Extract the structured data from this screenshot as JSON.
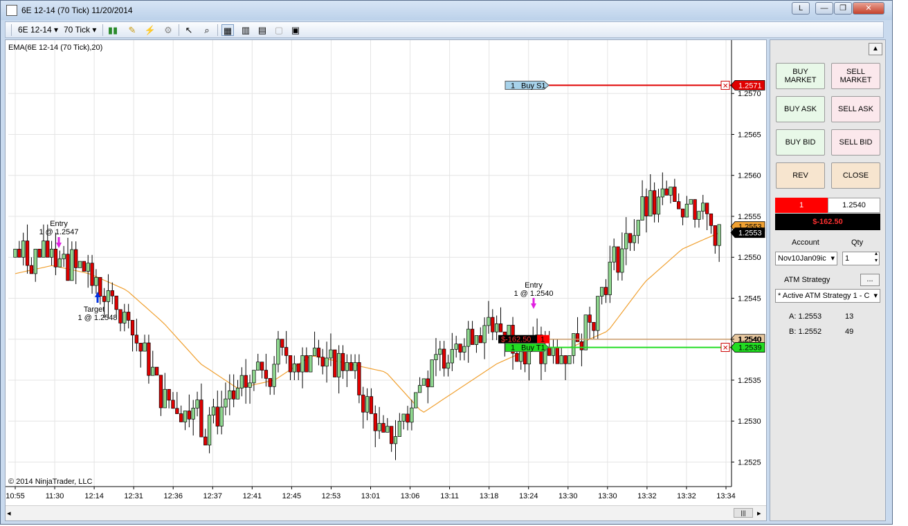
{
  "window": {
    "title": "6E 12-14 (70 Tick)  11/20/2014",
    "link_button": "L",
    "minimize_glyph": "—",
    "restore_glyph": "❐",
    "close_glyph": "✕"
  },
  "toolbar": {
    "instrument": "6E 12-14",
    "interval": "70 Tick"
  },
  "chart": {
    "indicator_label": "EMA(6E 12-14 (70 Tick),20)",
    "copyright": "© 2014 NinjaTrader, LLC",
    "y_ticks": [
      "1.2570",
      "1.2565",
      "1.2560",
      "1.2555",
      "1.2550",
      "1.2545",
      "1.2540",
      "1.2535",
      "1.2530",
      "1.2525"
    ],
    "x_ticks": [
      "10:55",
      "11:30",
      "12:14",
      "12:31",
      "12:36",
      "12:37",
      "12:41",
      "12:45",
      "12:53",
      "13:01",
      "13:06",
      "13:11",
      "13:18",
      "13:24",
      "13:30",
      "13:30",
      "13:32",
      "13:32",
      "13:34"
    ],
    "price_labels": {
      "buy_stop": "1.2571",
      "last": "1.2553",
      "avg_entry": "1.2540",
      "target": "1.2539",
      "ask_partial": "1.2553"
    },
    "order_tags": {
      "stop": {
        "qty": "1",
        "label": "Buy S1"
      },
      "target": {
        "qty": "1",
        "label": "Buy T1"
      },
      "position": {
        "pnl": "$-162.50",
        "qty": "1"
      }
    },
    "annotations": {
      "entry1": "Entry",
      "entry1_detail": "1 @ 1.2547",
      "target1": "Target",
      "target1_detail": "1 @ 1.2548",
      "entry2": "Entry",
      "entry2_detail": "1 @ 1.2540"
    },
    "colors": {
      "up": "#8fd88f",
      "down": "#e00000",
      "ema": "#f0a030",
      "stop_line": "#e00000",
      "target_line": "#22dd22",
      "entry_line": "#c99a6a"
    }
  },
  "chart_data": {
    "type": "candlestick",
    "title": "6E 12-14 (70 Tick)",
    "ylim": [
      1.2522,
      1.2575
    ],
    "series": [
      {
        "name": "EMA(6E 12-14 (70 Tick),20)",
        "values": [
          1.2548,
          1.2549,
          1.2548,
          1.2546,
          1.2542,
          1.2537,
          1.2534,
          1.2535,
          1.2538,
          1.2537,
          1.2536,
          1.2531,
          1.2534,
          1.2537,
          1.2539,
          1.2539,
          1.2541,
          1.2547,
          1.2551,
          1.2553
        ]
      },
      {
        "name": "Price",
        "values": [
          1.255,
          1.255,
          1.2548,
          1.2542,
          1.2533,
          1.253,
          1.2533,
          1.2538,
          1.2538,
          1.2537,
          1.2527,
          1.2535,
          1.2541,
          1.2542,
          1.2538,
          1.2538,
          1.2548,
          1.2556,
          1.2557,
          1.2553
        ]
      }
    ]
  },
  "panel": {
    "buttons": {
      "buy_market": "BUY\nMARKET",
      "sell_market": "SELL\nMARKET",
      "buy_ask": "BUY ASK",
      "sell_ask": "SELL ASK",
      "buy_bid": "BUY BID",
      "sell_bid": "SELL BID",
      "rev": "REV",
      "close": "CLOSE"
    },
    "position_qty": "1",
    "position_price": "1.2540",
    "pnl": "$-162.50",
    "account_label": "Account",
    "qty_label": "Qty",
    "account_value": "Nov10Jan09ic",
    "qty_value": "1",
    "atm_label": "ATM Strategy",
    "atm_value": "* Active ATM Strategy 1 - C",
    "more_button": "...",
    "ask_label": "A: 1.2553",
    "ask_size": "13",
    "bid_label": "B: 1.2552",
    "bid_size": "49"
  }
}
